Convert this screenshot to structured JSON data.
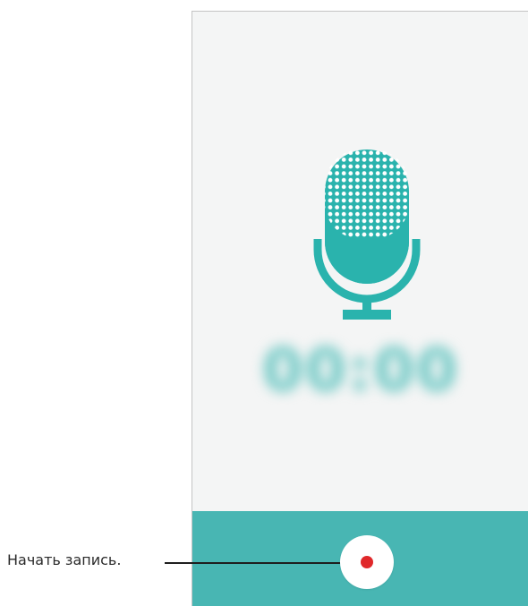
{
  "recorder": {
    "timer": "00:00",
    "colors": {
      "accent": "#48b6b3",
      "icon": "#2ab3ad",
      "record_dot": "#e0282a",
      "background": "#f4f5f5"
    }
  },
  "icons": {
    "microphone": "microphone-icon",
    "record": "record-dot-icon"
  },
  "callout": {
    "label": "Начать запись."
  }
}
